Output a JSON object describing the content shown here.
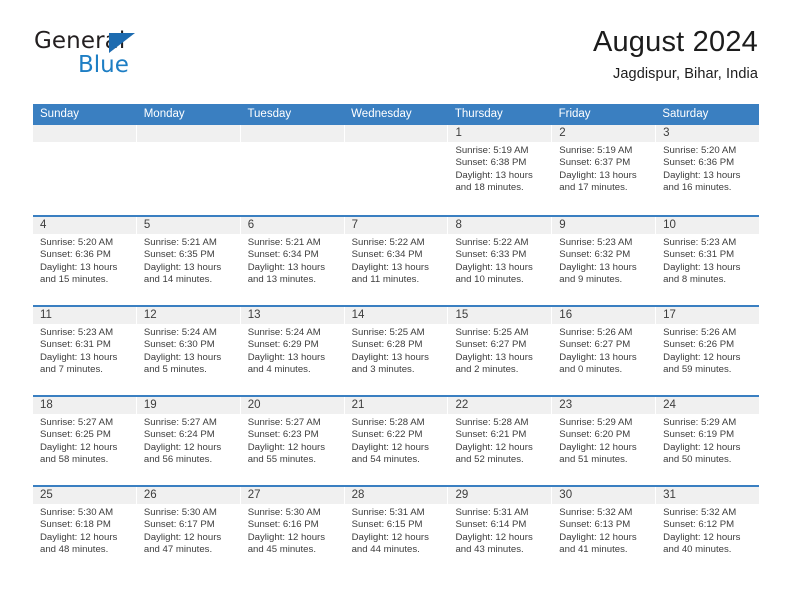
{
  "logo": {
    "line1": "General",
    "line2": "Blue",
    "triangle_icon": "blue-triangle-icon",
    "color_dark": "#231f20",
    "color_blue": "#1d7ec4"
  },
  "header": {
    "title": "August 2024",
    "subtitle": "Jagdispur, Bihar, India"
  },
  "theme": {
    "header_blue": "#3a7fc1",
    "band_gray": "#f0f0f0",
    "text": "#3d3d3d"
  },
  "weekdays": [
    "Sunday",
    "Monday",
    "Tuesday",
    "Wednesday",
    "Thursday",
    "Friday",
    "Saturday"
  ],
  "weeks": [
    [
      {
        "day": "",
        "empty": true
      },
      {
        "day": "",
        "empty": true
      },
      {
        "day": "",
        "empty": true
      },
      {
        "day": "",
        "empty": true
      },
      {
        "day": "1",
        "sunrise": "Sunrise: 5:19 AM",
        "sunset": "Sunset: 6:38 PM",
        "daylight": "Daylight: 13 hours and 18 minutes."
      },
      {
        "day": "2",
        "sunrise": "Sunrise: 5:19 AM",
        "sunset": "Sunset: 6:37 PM",
        "daylight": "Daylight: 13 hours and 17 minutes."
      },
      {
        "day": "3",
        "sunrise": "Sunrise: 5:20 AM",
        "sunset": "Sunset: 6:36 PM",
        "daylight": "Daylight: 13 hours and 16 minutes."
      }
    ],
    [
      {
        "day": "4",
        "sunrise": "Sunrise: 5:20 AM",
        "sunset": "Sunset: 6:36 PM",
        "daylight": "Daylight: 13 hours and 15 minutes."
      },
      {
        "day": "5",
        "sunrise": "Sunrise: 5:21 AM",
        "sunset": "Sunset: 6:35 PM",
        "daylight": "Daylight: 13 hours and 14 minutes."
      },
      {
        "day": "6",
        "sunrise": "Sunrise: 5:21 AM",
        "sunset": "Sunset: 6:34 PM",
        "daylight": "Daylight: 13 hours and 13 minutes."
      },
      {
        "day": "7",
        "sunrise": "Sunrise: 5:22 AM",
        "sunset": "Sunset: 6:34 PM",
        "daylight": "Daylight: 13 hours and 11 minutes."
      },
      {
        "day": "8",
        "sunrise": "Sunrise: 5:22 AM",
        "sunset": "Sunset: 6:33 PM",
        "daylight": "Daylight: 13 hours and 10 minutes."
      },
      {
        "day": "9",
        "sunrise": "Sunrise: 5:23 AM",
        "sunset": "Sunset: 6:32 PM",
        "daylight": "Daylight: 13 hours and 9 minutes."
      },
      {
        "day": "10",
        "sunrise": "Sunrise: 5:23 AM",
        "sunset": "Sunset: 6:31 PM",
        "daylight": "Daylight: 13 hours and 8 minutes."
      }
    ],
    [
      {
        "day": "11",
        "sunrise": "Sunrise: 5:23 AM",
        "sunset": "Sunset: 6:31 PM",
        "daylight": "Daylight: 13 hours and 7 minutes."
      },
      {
        "day": "12",
        "sunrise": "Sunrise: 5:24 AM",
        "sunset": "Sunset: 6:30 PM",
        "daylight": "Daylight: 13 hours and 5 minutes."
      },
      {
        "day": "13",
        "sunrise": "Sunrise: 5:24 AM",
        "sunset": "Sunset: 6:29 PM",
        "daylight": "Daylight: 13 hours and 4 minutes."
      },
      {
        "day": "14",
        "sunrise": "Sunrise: 5:25 AM",
        "sunset": "Sunset: 6:28 PM",
        "daylight": "Daylight: 13 hours and 3 minutes."
      },
      {
        "day": "15",
        "sunrise": "Sunrise: 5:25 AM",
        "sunset": "Sunset: 6:27 PM",
        "daylight": "Daylight: 13 hours and 2 minutes."
      },
      {
        "day": "16",
        "sunrise": "Sunrise: 5:26 AM",
        "sunset": "Sunset: 6:27 PM",
        "daylight": "Daylight: 13 hours and 0 minutes."
      },
      {
        "day": "17",
        "sunrise": "Sunrise: 5:26 AM",
        "sunset": "Sunset: 6:26 PM",
        "daylight": "Daylight: 12 hours and 59 minutes."
      }
    ],
    [
      {
        "day": "18",
        "sunrise": "Sunrise: 5:27 AM",
        "sunset": "Sunset: 6:25 PM",
        "daylight": "Daylight: 12 hours and 58 minutes."
      },
      {
        "day": "19",
        "sunrise": "Sunrise: 5:27 AM",
        "sunset": "Sunset: 6:24 PM",
        "daylight": "Daylight: 12 hours and 56 minutes."
      },
      {
        "day": "20",
        "sunrise": "Sunrise: 5:27 AM",
        "sunset": "Sunset: 6:23 PM",
        "daylight": "Daylight: 12 hours and 55 minutes."
      },
      {
        "day": "21",
        "sunrise": "Sunrise: 5:28 AM",
        "sunset": "Sunset: 6:22 PM",
        "daylight": "Daylight: 12 hours and 54 minutes."
      },
      {
        "day": "22",
        "sunrise": "Sunrise: 5:28 AM",
        "sunset": "Sunset: 6:21 PM",
        "daylight": "Daylight: 12 hours and 52 minutes."
      },
      {
        "day": "23",
        "sunrise": "Sunrise: 5:29 AM",
        "sunset": "Sunset: 6:20 PM",
        "daylight": "Daylight: 12 hours and 51 minutes."
      },
      {
        "day": "24",
        "sunrise": "Sunrise: 5:29 AM",
        "sunset": "Sunset: 6:19 PM",
        "daylight": "Daylight: 12 hours and 50 minutes."
      }
    ],
    [
      {
        "day": "25",
        "sunrise": "Sunrise: 5:30 AM",
        "sunset": "Sunset: 6:18 PM",
        "daylight": "Daylight: 12 hours and 48 minutes."
      },
      {
        "day": "26",
        "sunrise": "Sunrise: 5:30 AM",
        "sunset": "Sunset: 6:17 PM",
        "daylight": "Daylight: 12 hours and 47 minutes."
      },
      {
        "day": "27",
        "sunrise": "Sunrise: 5:30 AM",
        "sunset": "Sunset: 6:16 PM",
        "daylight": "Daylight: 12 hours and 45 minutes."
      },
      {
        "day": "28",
        "sunrise": "Sunrise: 5:31 AM",
        "sunset": "Sunset: 6:15 PM",
        "daylight": "Daylight: 12 hours and 44 minutes."
      },
      {
        "day": "29",
        "sunrise": "Sunrise: 5:31 AM",
        "sunset": "Sunset: 6:14 PM",
        "daylight": "Daylight: 12 hours and 43 minutes."
      },
      {
        "day": "30",
        "sunrise": "Sunrise: 5:32 AM",
        "sunset": "Sunset: 6:13 PM",
        "daylight": "Daylight: 12 hours and 41 minutes."
      },
      {
        "day": "31",
        "sunrise": "Sunrise: 5:32 AM",
        "sunset": "Sunset: 6:12 PM",
        "daylight": "Daylight: 12 hours and 40 minutes."
      }
    ]
  ]
}
